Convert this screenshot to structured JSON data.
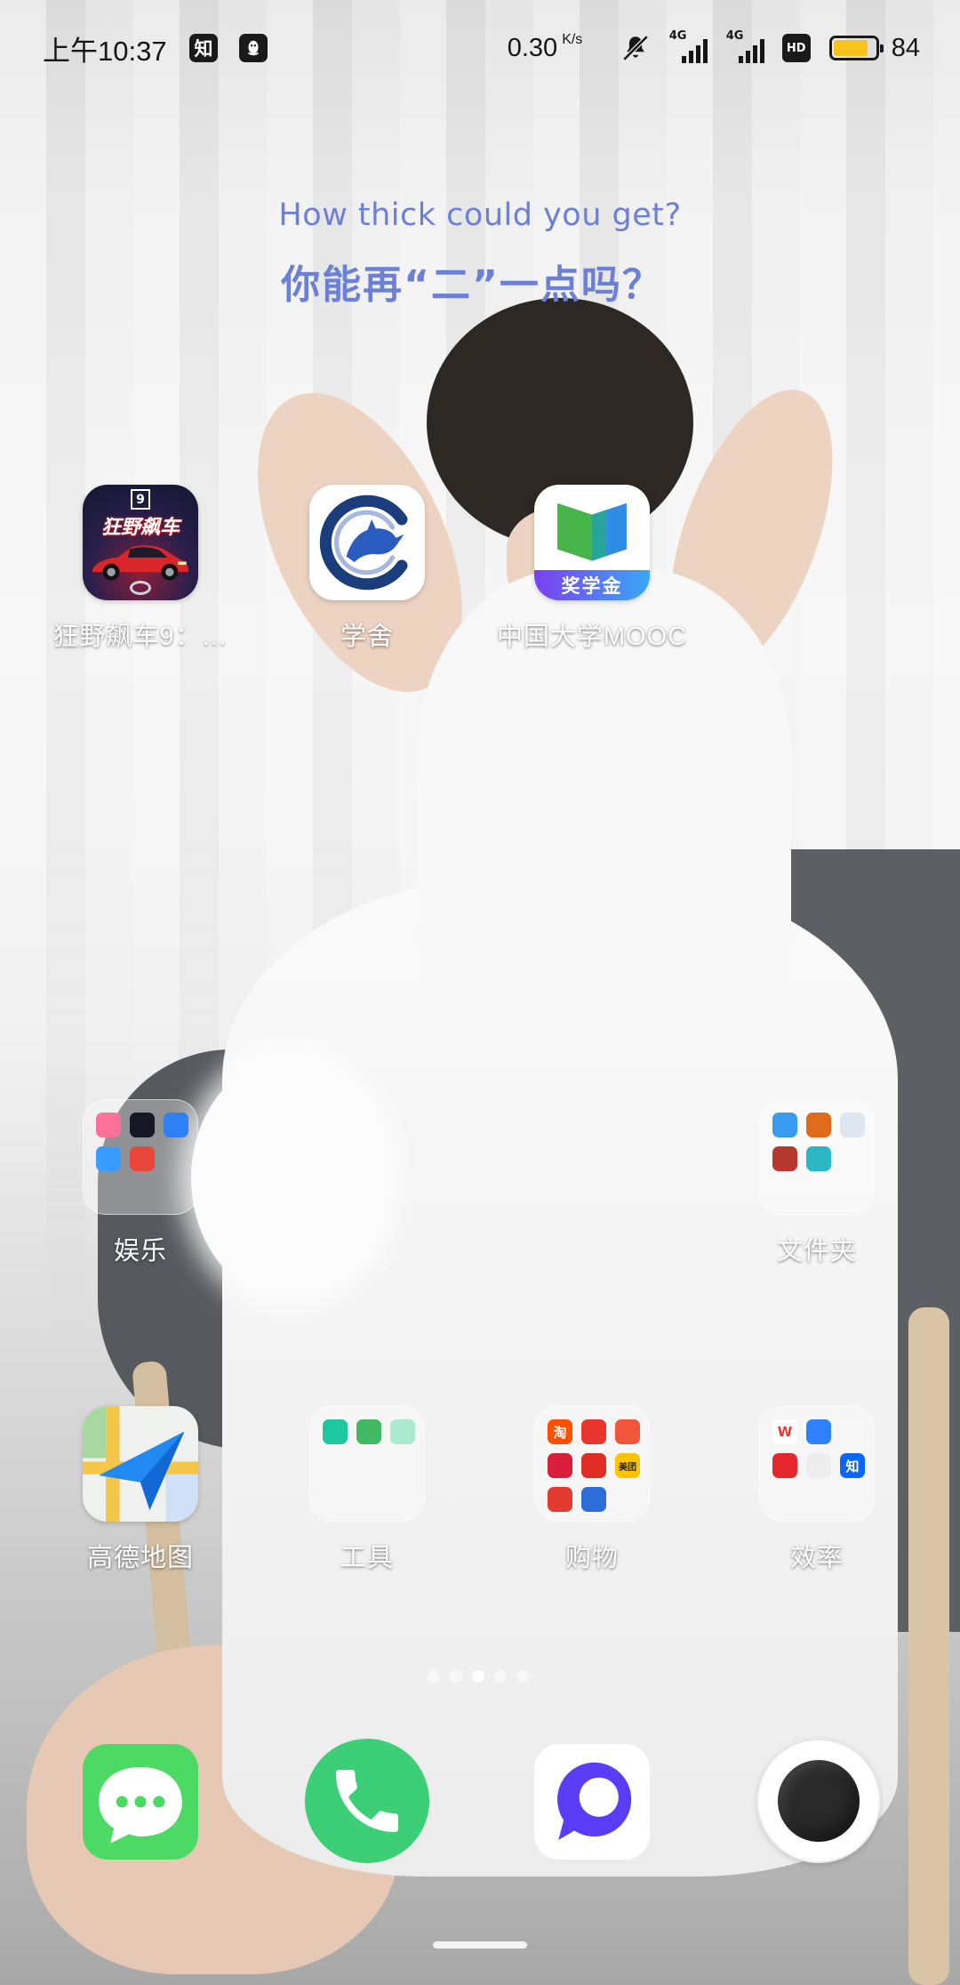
{
  "status_bar": {
    "time": "上午10:37",
    "zhihu_badge": "知",
    "qq_icon": "qq-penguin-icon",
    "net_speed": "0.30",
    "net_unit": "K/s",
    "mute_icon": "bell-mute-icon",
    "sim1": {
      "type": "4G",
      "bars": 4
    },
    "sim2": {
      "type": "4G",
      "bars": 4
    },
    "hd_badge": "HD",
    "battery": {
      "level_text": "84",
      "level": 0.84,
      "color": "#f7c21b"
    }
  },
  "widget": {
    "line1": "How thick could you get?",
    "line2": "你能再“二”一点吗？",
    "color": "#6c80d6"
  },
  "apps": {
    "asphalt": {
      "label": "狂野飙车9：…",
      "icon": "asphalt-9-icon",
      "badge": "9",
      "logo_text": "狂野飙车"
    },
    "xueshe": {
      "label": "学舍",
      "icon": "dolphin-c-icon"
    },
    "mooc": {
      "label": "中国大学MOOC",
      "icon": "open-book-icon",
      "banner": "奖学金"
    },
    "amap": {
      "label": "高德地图",
      "icon": "paper-plane-map-icon"
    }
  },
  "folders": {
    "entertainment": {
      "label": "娱乐",
      "items": [
        {
          "icon": "bilibili-icon",
          "color": "#fb7299"
        },
        {
          "icon": "douyin-icon",
          "color": "#161823"
        },
        {
          "icon": "browser-icon",
          "color": "#2f7ff5"
        },
        {
          "icon": "video-play-icon",
          "color": "#3b9cff"
        },
        {
          "icon": "reading-app-icon",
          "color": "#e9463a"
        }
      ]
    },
    "files": {
      "label": "文件夹",
      "items": [
        {
          "icon": "blue-ring-app-icon",
          "color": "#3a9cf0"
        },
        {
          "icon": "fire-game-icon",
          "color": "#e26a1c"
        },
        {
          "icon": "panda-game-icon",
          "color": "#dfe6ef"
        },
        {
          "icon": "racing-game-icon",
          "color": "#b6382f"
        },
        {
          "icon": "black-ball-app-icon",
          "color": "#2bb8c4"
        }
      ]
    },
    "tools": {
      "label": "工具",
      "items": [
        {
          "icon": "umbrella-weather-icon",
          "color": "#1ec7a0"
        },
        {
          "icon": "location-pin-icon",
          "color": "#43b865"
        },
        {
          "icon": "green-utility-icon",
          "color": "#a9ead1"
        }
      ]
    },
    "shopping": {
      "label": "购物",
      "items": [
        {
          "icon": "taobao-icon",
          "color": "#ff5000",
          "glyph": "淘"
        },
        {
          "icon": "tmall-icon",
          "color": "#e8352f"
        },
        {
          "icon": "jd-daojia-icon",
          "color": "#f1553a"
        },
        {
          "icon": "red-shop-icon",
          "color": "#d81e3a"
        },
        {
          "icon": "pinduoduo-icon",
          "color": "#e02e24"
        },
        {
          "icon": "meituan-icon",
          "color": "#ffc300",
          "glyph": "美团",
          "fg": "#222222"
        },
        {
          "icon": "red-card-icon",
          "color": "#e23b32"
        },
        {
          "icon": "railway-12306-icon",
          "color": "#2c6dd8"
        }
      ]
    },
    "efficiency": {
      "label": "效率",
      "items": [
        {
          "icon": "wps-icon",
          "color": "#ffffff",
          "glyph": "W",
          "fg": "#e53935"
        },
        {
          "icon": "blue-pen-icon",
          "color": "#2f80ff"
        },
        {
          "icon": "colorful-grid-icon",
          "color": "#f7f7f7"
        },
        {
          "icon": "youdao-dict-icon",
          "color": "#e5262c"
        },
        {
          "icon": "reader-book-icon",
          "color": "#ededed"
        },
        {
          "icon": "zhihu-icon",
          "color": "#0a66ff",
          "glyph": "知"
        }
      ]
    }
  },
  "page_indicator": {
    "count": 5,
    "active": 3
  },
  "dock": [
    {
      "icon": "chat-bubble-icon",
      "color": "#4cd964"
    },
    {
      "icon": "phone-handset-icon",
      "color": "#3ccf78"
    },
    {
      "icon": "purple-ring-app-icon",
      "color": "#5b3cf5"
    },
    {
      "icon": "camera-shutter-icon",
      "color": "#2a2a2a"
    }
  ]
}
